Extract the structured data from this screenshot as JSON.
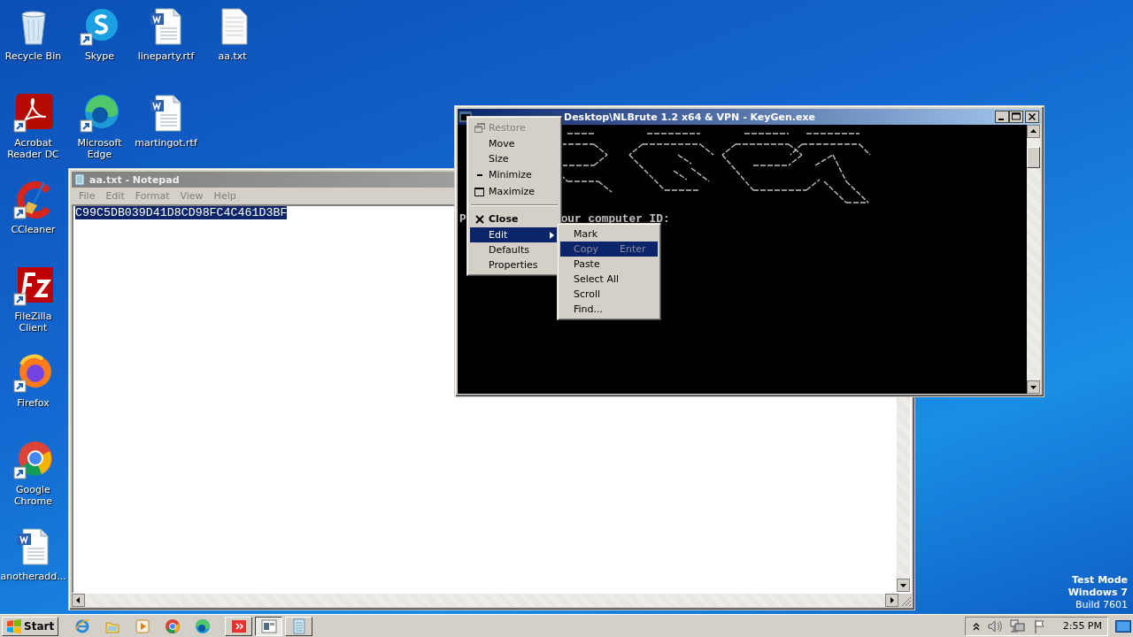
{
  "desktop": {
    "columns": [
      [
        {
          "label": "Recycle Bin",
          "kind": "recycle-bin",
          "shortcut": false
        },
        {
          "label": "Acrobat Reader DC",
          "kind": "acrobat",
          "shortcut": true
        },
        {
          "label": "CCleaner",
          "kind": "ccleaner",
          "shortcut": true
        },
        {
          "label": "FileZilla Client",
          "kind": "filezilla",
          "shortcut": true
        },
        {
          "label": "Firefox",
          "kind": "firefox",
          "shortcut": true
        },
        {
          "label": "Google Chrome",
          "kind": "chrome",
          "shortcut": true
        },
        {
          "label": "anotheradd...",
          "kind": "word-doc",
          "shortcut": false
        }
      ],
      [
        {
          "label": "Skype",
          "kind": "skype",
          "shortcut": true
        },
        {
          "label": "Microsoft Edge",
          "kind": "edge",
          "shortcut": true
        }
      ],
      [
        {
          "label": "lineparty.rtf",
          "kind": "word-doc",
          "shortcut": false
        },
        {
          "label": "martingot.rtf",
          "kind": "word-doc",
          "shortcut": false
        }
      ],
      [
        {
          "label": "aa.txt",
          "kind": "text-doc",
          "shortcut": false
        }
      ]
    ],
    "os_notice": [
      {
        "text": "Test Mode",
        "bold": true
      },
      {
        "text": "Windows 7",
        "bold": true
      },
      {
        "text": "Build 7601",
        "bold": false
      }
    ]
  },
  "notepad": {
    "title": "aa.txt - Notepad",
    "active": false,
    "menu": [
      "File",
      "Edit",
      "Format",
      "View",
      "Help"
    ],
    "text": "C99C5DB039D41D8CD98FC4C461D3BF",
    "text_selected": true
  },
  "console": {
    "title": "Desktop\\NLBrute 1.2 x64 & VPN - KeyGen.exe",
    "active": true,
    "prompt_parts": [
      "P",
      "our computer ID:"
    ]
  },
  "system_menu": {
    "items": [
      {
        "kind": "restore",
        "label": "Restore",
        "disabled": true,
        "selected": false,
        "default": false,
        "submenu": false
      },
      {
        "kind": "item",
        "label": "Move",
        "disabled": false,
        "selected": false,
        "default": false,
        "submenu": false
      },
      {
        "kind": "item",
        "label": "Size",
        "disabled": false,
        "selected": false,
        "default": false,
        "submenu": false
      },
      {
        "kind": "minimize",
        "label": "Minimize",
        "disabled": false,
        "selected": false,
        "default": false,
        "submenu": false
      },
      {
        "kind": "maximize",
        "label": "Maximize",
        "disabled": false,
        "selected": false,
        "default": false,
        "submenu": false
      },
      {
        "kind": "separator"
      },
      {
        "kind": "close",
        "label": "Close",
        "disabled": false,
        "selected": false,
        "default": true,
        "submenu": false
      },
      {
        "kind": "item",
        "label": "Edit",
        "disabled": false,
        "selected": true,
        "default": false,
        "submenu": true
      },
      {
        "kind": "item",
        "label": "Defaults",
        "disabled": false,
        "selected": false,
        "default": false,
        "submenu": false
      },
      {
        "kind": "item",
        "label": "Properties",
        "disabled": false,
        "selected": false,
        "default": false,
        "submenu": false
      }
    ]
  },
  "edit_submenu": {
    "items": [
      {
        "label": "Mark",
        "disabled": false,
        "selected": false
      },
      {
        "label": "Copy",
        "shortcut": "Enter",
        "disabled": true,
        "selected": true
      },
      {
        "label": "Paste",
        "disabled": false,
        "selected": false
      },
      {
        "label": "Select All",
        "disabled": false,
        "selected": false
      },
      {
        "label": "Scroll",
        "disabled": false,
        "selected": false
      },
      {
        "label": "Find...",
        "disabled": false,
        "selected": false
      }
    ]
  },
  "taskbar": {
    "start": "Start",
    "quick_launch": [
      {
        "kind": "ie"
      },
      {
        "kind": "explorer"
      },
      {
        "kind": "media"
      },
      {
        "kind": "chrome"
      },
      {
        "kind": "edge"
      }
    ],
    "tasks": [
      {
        "kind": "red-app",
        "selected": false
      },
      {
        "kind": "console",
        "selected": true
      },
      {
        "kind": "notepad",
        "selected": false
      }
    ],
    "tray": {
      "clock": "2:55 PM"
    }
  }
}
